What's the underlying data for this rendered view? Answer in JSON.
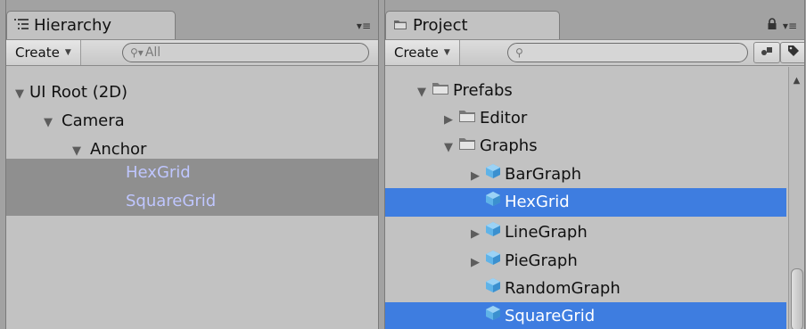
{
  "hierarchy": {
    "tab_label": "Hierarchy",
    "create_label": "Create",
    "search_placeholder": "All",
    "items": [
      {
        "label": "UI Root (2D)",
        "fold": "▼"
      },
      {
        "label": "Camera",
        "fold": "▼"
      },
      {
        "label": "Anchor",
        "fold": "▼"
      },
      {
        "label": "HexGrid",
        "fold": ""
      },
      {
        "label": "SquareGrid",
        "fold": ""
      }
    ]
  },
  "project": {
    "tab_label": "Project",
    "create_label": "Create",
    "search_value": "",
    "items": [
      {
        "label": "Prefabs",
        "fold": "▼",
        "icon": "folder-icon"
      },
      {
        "label": "Editor",
        "fold": "▶",
        "icon": "folder-icon"
      },
      {
        "label": "Graphs",
        "fold": "▼",
        "icon": "folder-icon"
      },
      {
        "label": "BarGraph",
        "fold": "▶",
        "icon": "prefab-cube-icon"
      },
      {
        "label": "HexGrid",
        "fold": "",
        "icon": "prefab-cube-icon"
      },
      {
        "label": "LineGraph",
        "fold": "▶",
        "icon": "prefab-cube-icon"
      },
      {
        "label": "PieGraph",
        "fold": "▶",
        "icon": "prefab-cube-icon"
      },
      {
        "label": "RandomGraph",
        "fold": "",
        "icon": "prefab-cube-icon"
      },
      {
        "label": "SquareGrid",
        "fold": "",
        "icon": "prefab-cube-icon"
      }
    ]
  },
  "colors": {
    "selection_blue": "#3e7de0",
    "selection_grey": "#8f8f8f",
    "selected_text_grey": "#bfc6ff",
    "panel_bg": "#c2c2c2"
  }
}
